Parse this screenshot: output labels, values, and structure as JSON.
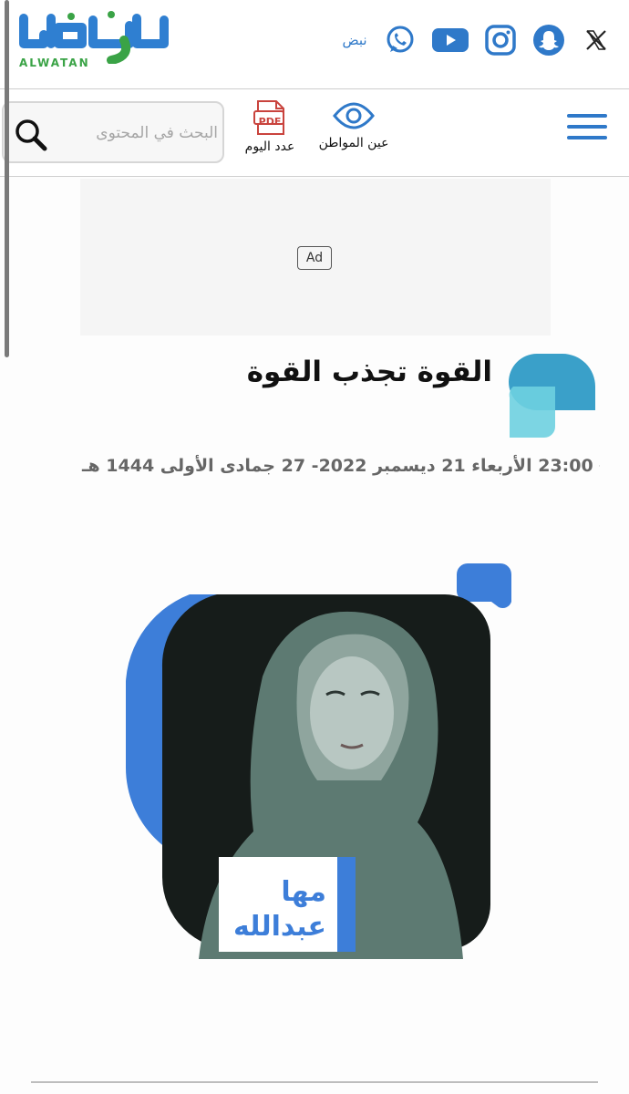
{
  "header": {
    "logo_text": "الوطن",
    "logo_sub": "ALWATAN",
    "nabd_label": "نبض",
    "social_icons": [
      "whatsapp-icon",
      "youtube-icon",
      "instagram-icon",
      "snapchat-icon",
      "x-icon"
    ]
  },
  "nav": {
    "search_placeholder": "البحث في المحتوى",
    "today_issue_label": "عدد اليوم",
    "pdf_badge": "PDF",
    "citizen_eye_label": "عين المواطن"
  },
  "ad": {
    "label": "Ad"
  },
  "article": {
    "title": "القوة تجذب القوة",
    "date": "23:00 الأربعاء 21 ديسمبر 2022- 27 جمادى الأولى 1444 هـ",
    "author_first": "مها",
    "author_last": "عبدالله"
  },
  "colors": {
    "brand_blue": "#2f79c9",
    "brand_green": "#3aa346",
    "accent_teal": "#3fa3c9",
    "author_blue": "#3d7ed9"
  }
}
